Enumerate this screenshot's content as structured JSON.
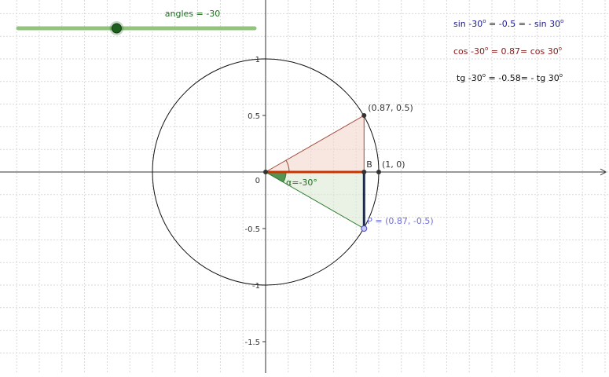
{
  "slider": {
    "label": "angles = -30",
    "min": -180,
    "max": 180,
    "value": -30,
    "track_color": "#93c47d",
    "knob_color": "#1e5e1e"
  },
  "equations": {
    "sin": {
      "pre": "sin -30",
      "deg1": "o",
      "mid": " = -0.5 = - sin 30",
      "deg2": "o",
      "color": "#1a1a8c"
    },
    "cos": {
      "pre": "cos -30",
      "deg1": "o",
      "mid": " = 0.87= cos 30",
      "deg2": "o",
      "color": "#8b1a1a"
    },
    "tg": {
      "pre": "tg -30",
      "deg1": "o",
      "mid": " = -0.58= - tg 30",
      "deg2": "o",
      "color": "#111111"
    }
  },
  "axes": {
    "y_ticks": [
      "1",
      "0.5",
      "0",
      "-0.5",
      "-1",
      "-1.5"
    ],
    "y_tick_values": [
      1,
      0.5,
      0,
      -0.5,
      -1,
      -1.5
    ],
    "grid": true
  },
  "points": {
    "upper": {
      "label": "(0.87, 0.5)",
      "x": 0.87,
      "y": 0.5
    },
    "B": {
      "label": "B",
      "x": 0.87,
      "y": 0
    },
    "unit": {
      "label": "(1, 0)",
      "x": 1,
      "y": 0
    },
    "P": {
      "label": "P = (0.87, -0.5)",
      "x": 0.87,
      "y": -0.5
    }
  },
  "angle": {
    "label": "α=-30°",
    "degrees": -30
  },
  "colors": {
    "upper_fill": "#f4d6cc",
    "lower_fill": "#dcead4",
    "cos_segment": "#cc3300",
    "sin_segment": "#1c2a4a",
    "lower_line": "#2e7d2e",
    "upper_line": "#a04a3a",
    "angle_fill": "#2e7d2e",
    "point_P": "#6f6fe0"
  }
}
